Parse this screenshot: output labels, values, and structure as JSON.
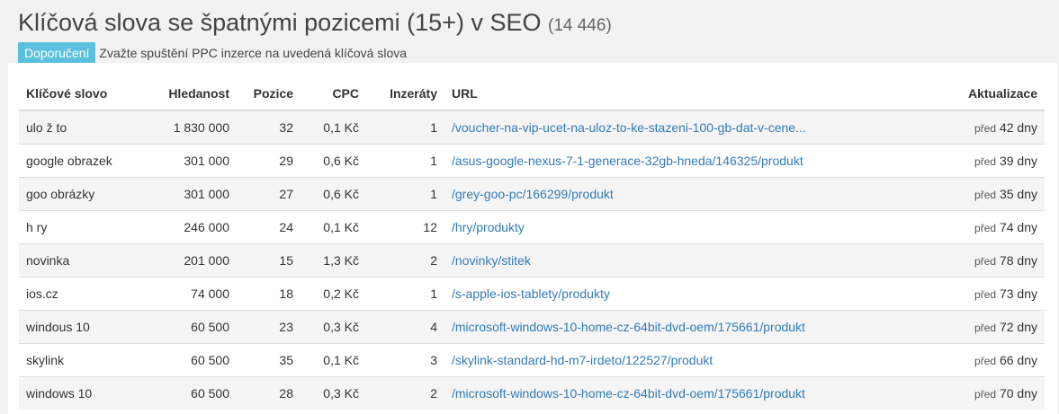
{
  "header": {
    "title": "Klíčová slova se špatnými pozicemi (15+) v SEO",
    "count": "(14 446)",
    "badge": "Doporučení",
    "recommendation": "Zvažte spuštění PPC inzerce na uvedená klíčová slova"
  },
  "colors": {
    "badge": "#5bc0de",
    "link": "#337ab7"
  },
  "table": {
    "columns": [
      "Klíčové slovo",
      "Hledanost",
      "Pozice",
      "CPC",
      "Inzeráty",
      "URL",
      "Aktualizace"
    ],
    "rows": [
      {
        "keyword": "ulo ž to",
        "volume": "1 830 000",
        "position": "32",
        "cpc": "0,1 Kč",
        "ads": "1",
        "url": "/voucher-na-vip-ucet-na-uloz-to-ke-stazeni-100-gb-dat-v-cene...",
        "ago_prefix": "před",
        "ago": "42 dny"
      },
      {
        "keyword": "google obrazek",
        "volume": "301 000",
        "position": "29",
        "cpc": "0,6 Kč",
        "ads": "1",
        "url": "/asus-google-nexus-7-1-generace-32gb-hneda/146325/produkt",
        "ago_prefix": "před",
        "ago": "39 dny"
      },
      {
        "keyword": "goo obrázky",
        "volume": "301 000",
        "position": "27",
        "cpc": "0,6 Kč",
        "ads": "1",
        "url": "/grey-goo-pc/166299/produkt",
        "ago_prefix": "před",
        "ago": "35 dny"
      },
      {
        "keyword": "h ry",
        "volume": "246 000",
        "position": "24",
        "cpc": "0,1 Kč",
        "ads": "12",
        "url": "/hry/produkty",
        "ago_prefix": "před",
        "ago": "74 dny"
      },
      {
        "keyword": "novinka",
        "volume": "201 000",
        "position": "15",
        "cpc": "1,3 Kč",
        "ads": "2",
        "url": "/novinky/stitek",
        "ago_prefix": "před",
        "ago": "78 dny"
      },
      {
        "keyword": "ios.cz",
        "volume": "74 000",
        "position": "18",
        "cpc": "0,2 Kč",
        "ads": "1",
        "url": "/s-apple-ios-tablety/produkty",
        "ago_prefix": "před",
        "ago": "73 dny"
      },
      {
        "keyword": "windous 10",
        "volume": "60 500",
        "position": "23",
        "cpc": "0,3 Kč",
        "ads": "4",
        "url": "/microsoft-windows-10-home-cz-64bit-dvd-oem/175661/produkt",
        "ago_prefix": "před",
        "ago": "72 dny"
      },
      {
        "keyword": "skylink",
        "volume": "60 500",
        "position": "35",
        "cpc": "0,1 Kč",
        "ads": "3",
        "url": "/skylink-standard-hd-m7-irdeto/122527/produkt",
        "ago_prefix": "před",
        "ago": "66 dny"
      },
      {
        "keyword": "windows 10",
        "volume": "60 500",
        "position": "28",
        "cpc": "0,3 Kč",
        "ads": "2",
        "url": "/microsoft-windows-10-home-cz-64bit-dvd-oem/175661/produkt",
        "ago_prefix": "před",
        "ago": "70 dny"
      }
    ]
  }
}
